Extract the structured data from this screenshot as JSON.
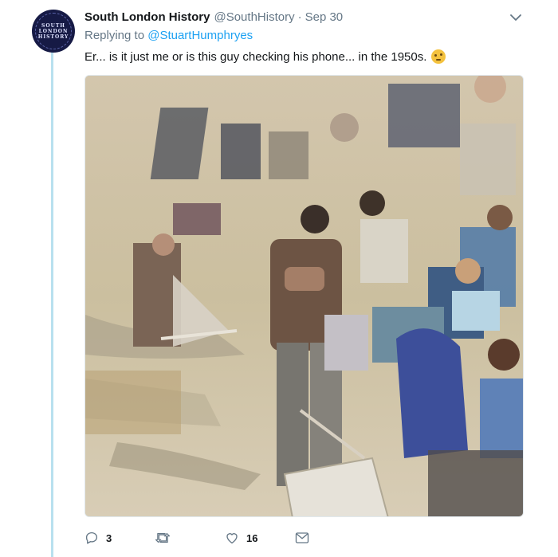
{
  "tweet": {
    "author_name": "South London History",
    "author_handle": "@SouthHistory",
    "separator": "·",
    "date": "Sep 30",
    "replying_prefix": "Replying to",
    "replying_to": "@StuartHumphryes",
    "text": "Er... is it just me or is this guy checking his phone... in the 1950s.",
    "emoji_icon": "thinking-face-icon"
  },
  "avatar": {
    "lines": [
      "SOUTH",
      "LONDON",
      "HISTORY"
    ]
  },
  "actions": {
    "reply_count": "3",
    "retweet_count": "",
    "like_count": "16"
  },
  "colors": {
    "accent": "#1da1f2",
    "muted": "#657786",
    "thread_line": "#b8e0ef"
  }
}
